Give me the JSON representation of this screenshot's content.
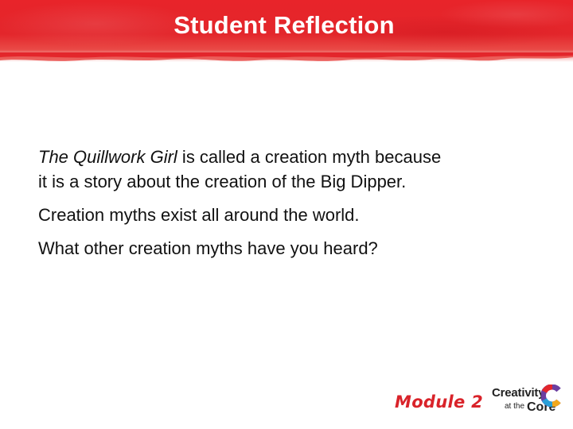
{
  "slide": {
    "title": "Student Reflection",
    "colors": {
      "header": "#e3262b",
      "module_text": "#d9232a",
      "body_text": "#111111"
    }
  },
  "body": {
    "paragraph1": {
      "italic_title": "The Quillwork Girl",
      "rest_line1": " is called a creation myth because",
      "rest_line2": "it is a story about the creation of the Big Dipper."
    },
    "paragraph2": "Creation myths exist all around the world.",
    "paragraph3": "What other creation myths have you heard?"
  },
  "footer": {
    "module_label": "Module 2",
    "brand": {
      "line1": "Creativity",
      "line2": "at the",
      "line3": "Core",
      "icon": "creativity-c-logo-icon"
    }
  }
}
